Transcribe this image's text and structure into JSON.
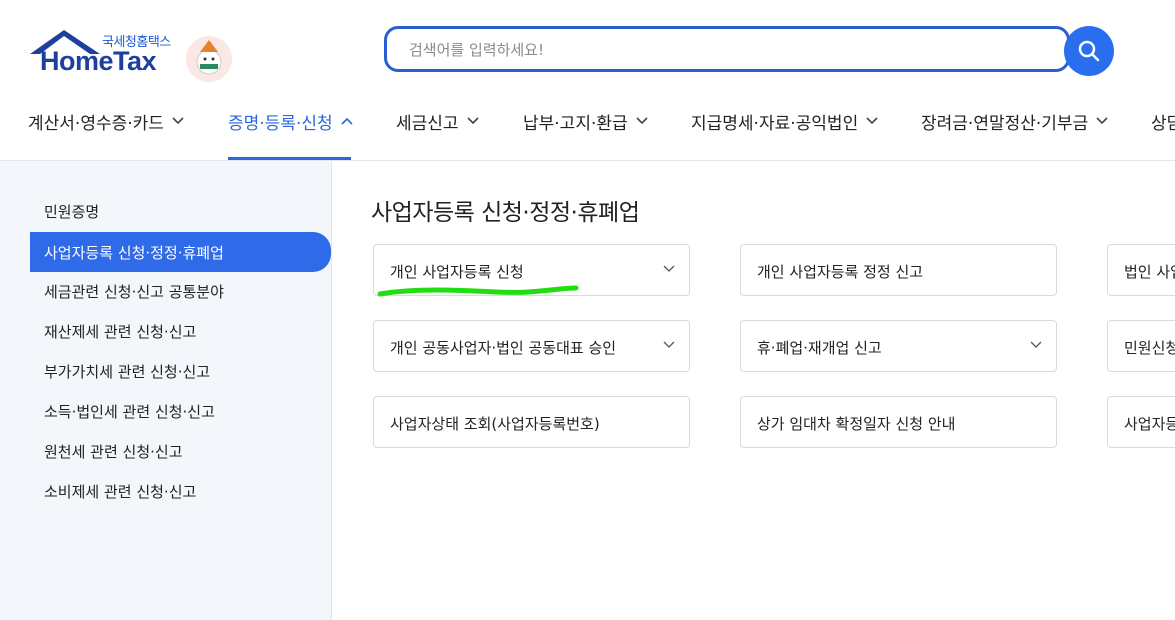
{
  "logo": {
    "subtitle": "국세청홈택스",
    "name": "HomeTax"
  },
  "search": {
    "placeholder": "검색어를 입력하세요!",
    "value": ""
  },
  "nav": {
    "items": [
      "계산서·영수증·카드",
      "증명·등록·신청",
      "세금신고",
      "납부·고지·환급",
      "지급명세·자료·공익법인",
      "장려금·연말정산·기부금",
      "상담"
    ],
    "active_index": 1
  },
  "sidebar": {
    "items": [
      "민원증명",
      "사업자등록 신청·정정·휴폐업",
      "세금관련 신청·신고 공통분야",
      "재산제세 관련 신청·신고",
      "부가가치세 관련 신청·신고",
      "소득·법인세 관련 신청·신고",
      "원천세 관련 신청·신고",
      "소비제세 관련 신청·신고"
    ],
    "active_index": 1
  },
  "main": {
    "title": "사업자등록 신청·정정·휴폐업",
    "cards": [
      [
        "개인 사업자등록 신청",
        "개인 사업자등록 정정 신고",
        "법인 사업"
      ],
      [
        "개인 공동사업자·법인 공동대표 승인",
        "휴·폐업·재개업 신고",
        "민원신청"
      ],
      [
        "사업자상태 조회(사업자등록번호)",
        "상가 임대차 확정일자 신청 안내",
        "사업자등"
      ]
    ]
  },
  "colors": {
    "accent": "#2a67e0",
    "highlight": "#22dd11"
  }
}
